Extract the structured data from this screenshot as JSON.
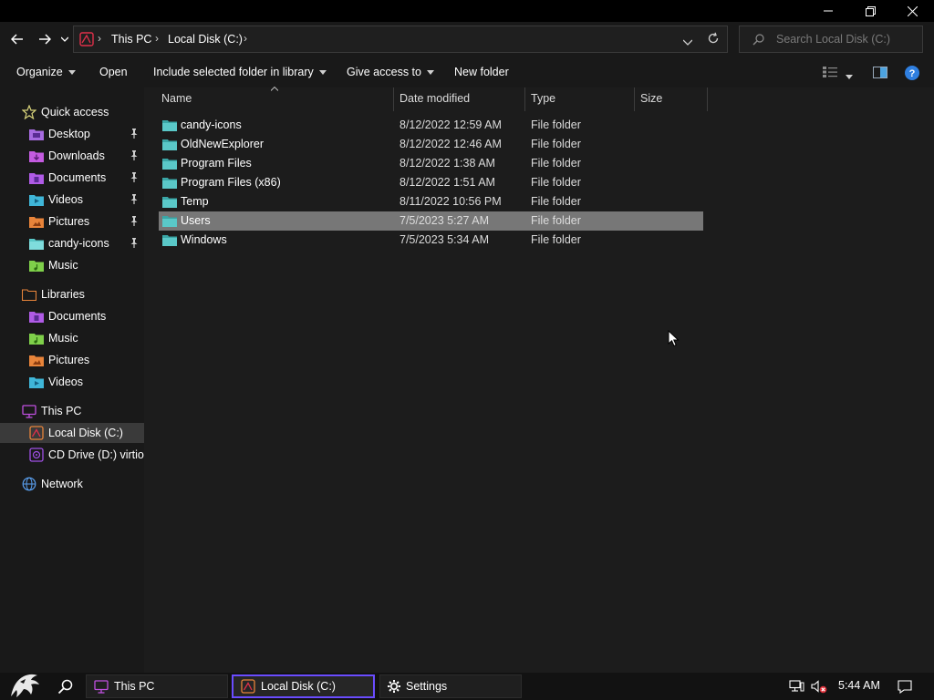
{
  "window": {
    "controls": [
      "minimize",
      "restore",
      "close"
    ]
  },
  "address": {
    "crumbs": [
      "This PC",
      "Local Disk (C:)"
    ],
    "search_placeholder": "Search Local Disk (C:)"
  },
  "toolbar": {
    "organize": "Organize",
    "open": "Open",
    "include": "Include selected folder in library",
    "give_access": "Give access to",
    "new_folder": "New folder"
  },
  "sidebar": {
    "quick_access": "Quick access",
    "quick_items": [
      {
        "label": "Desktop",
        "icon": "desktop-folder-icon",
        "color": "#a76be0",
        "pinned": true
      },
      {
        "label": "Downloads",
        "icon": "downloads-folder-icon",
        "color": "#c45be0",
        "pinned": true
      },
      {
        "label": "Documents",
        "icon": "documents-folder-icon",
        "color": "#b05be6",
        "pinned": true
      },
      {
        "label": "Videos",
        "icon": "videos-folder-icon",
        "color": "#3fb6d8",
        "pinned": true
      },
      {
        "label": "Pictures",
        "icon": "pictures-folder-icon",
        "color": "#e8843a",
        "pinned": true
      },
      {
        "label": "candy-icons",
        "icon": "folder-icon",
        "color": "#5ac8c8",
        "pinned": true
      },
      {
        "label": "Music",
        "icon": "music-folder-icon",
        "color": "#7fd04a",
        "pinned": false
      }
    ],
    "libraries": "Libraries",
    "library_items": [
      {
        "label": "Documents",
        "icon": "documents-folder-icon",
        "color": "#b05be6"
      },
      {
        "label": "Music",
        "icon": "music-folder-icon",
        "color": "#7fd04a"
      },
      {
        "label": "Pictures",
        "icon": "pictures-folder-icon",
        "color": "#e8843a"
      },
      {
        "label": "Videos",
        "icon": "videos-folder-icon",
        "color": "#3fb6d8"
      }
    ],
    "this_pc": "This PC",
    "pc_items": [
      {
        "label": "Local Disk (C:)",
        "icon": "drive-icon"
      },
      {
        "label": "CD Drive (D:) virtio-",
        "icon": "cd-drive-icon"
      }
    ],
    "network": "Network"
  },
  "columns": [
    "Name",
    "Date modified",
    "Type",
    "Size"
  ],
  "files": [
    {
      "name": "candy-icons",
      "date": "8/12/2022 12:59 AM",
      "type": "File folder",
      "size": ""
    },
    {
      "name": "OldNewExplorer",
      "date": "8/12/2022 12:46 AM",
      "type": "File folder",
      "size": ""
    },
    {
      "name": "Program Files",
      "date": "8/12/2022 1:38 AM",
      "type": "File folder",
      "size": ""
    },
    {
      "name": "Program Files (x86)",
      "date": "8/12/2022 1:51 AM",
      "type": "File folder",
      "size": ""
    },
    {
      "name": "Temp",
      "date": "8/11/2022 10:56 PM",
      "type": "File folder",
      "size": ""
    },
    {
      "name": "Users",
      "date": "7/5/2023 5:27 AM",
      "type": "File folder",
      "size": "",
      "selected": true
    },
    {
      "name": "Windows",
      "date": "7/5/2023 5:34 AM",
      "type": "File folder",
      "size": ""
    }
  ],
  "taskbar": {
    "apps": [
      {
        "label": "This PC",
        "icon": "monitor-icon"
      },
      {
        "label": "Local Disk (C:)",
        "icon": "drive-icon",
        "active": true
      },
      {
        "label": "Settings",
        "icon": "gear-icon"
      }
    ],
    "clock": "5:44 AM"
  },
  "colors": {
    "accent": "#6a4cff",
    "folder": "#5ac8c8",
    "selection": "#777777",
    "help": "#2f7fe0"
  }
}
